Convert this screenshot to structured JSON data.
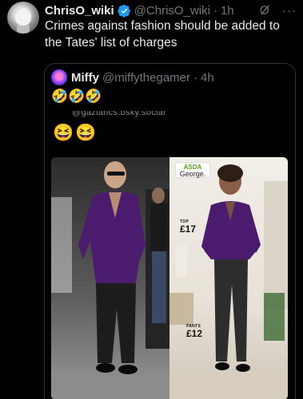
{
  "tweet": {
    "display_name": "ChrisO_wiki",
    "handle": "@ChrisO_wiki",
    "separator": "·",
    "time": "1h",
    "text": "Crimes against fashion should be added to the Tates' list of charges",
    "more": "···"
  },
  "quote": {
    "display_name": "Miffy",
    "handle": "@miffythegamer",
    "separator": "·",
    "time": "4h",
    "text": "🤣🤣🤣",
    "image": {
      "faded_url": "@gaziancs.bsky.social",
      "emojis": "😆😆",
      "brand_line1": "ASDA",
      "brand_line2": "George.",
      "top_label": "TOP",
      "top_price": "£17",
      "pants_label": "PANTS",
      "pants_price": "£12"
    }
  },
  "colors": {
    "background": "#000000",
    "text": "#e7e9ea",
    "muted": "#71767b",
    "border": "#2f3336",
    "verified": "#1d9bf0",
    "shirt_purple": "#4b1c6e"
  }
}
